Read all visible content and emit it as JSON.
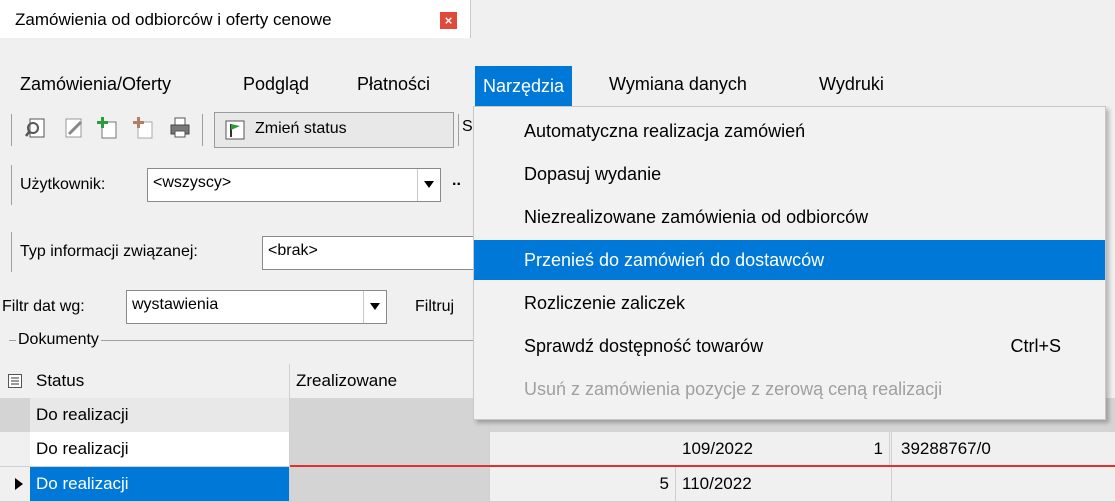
{
  "tab": {
    "title": "Zamówienia od odbiorców i oferty cenowe",
    "close": "×"
  },
  "menu": {
    "items": [
      "Zamówienia/Oferty",
      "Podgląd",
      "Płatności",
      "Narzędzia",
      "Wymiana danych",
      "Wydruki"
    ]
  },
  "toolbar": {
    "change_status": "Zmień status",
    "cut_text": "S"
  },
  "filters": {
    "user_label": "Użytkownik:",
    "user_value": "<wszyscy>",
    "user_more": "..",
    "info_type_label": "Typ informacji związanej:",
    "info_type_value": "<brak>",
    "date_filter_label": "Filtr dat wg:",
    "date_filter_value": "wystawienia",
    "filter_label": "Filtruj"
  },
  "documents": {
    "group_label": "Dokumenty",
    "columns": [
      "Status",
      "Zrealizowane"
    ],
    "rows": [
      {
        "status": "Do realizacji",
        "realized": "",
        "count": "",
        "number": "",
        "ref": ""
      },
      {
        "status": "Do realizacji",
        "realized": "",
        "count": "1",
        "number": "109/2022",
        "ref": "39288767/0"
      },
      {
        "status": "Do realizacji",
        "realized": "",
        "count": "5",
        "number": "110/2022",
        "ref": ""
      }
    ]
  },
  "dropdown": {
    "items": [
      {
        "label": "Automatyczna realizacja zamówień",
        "shortcut": "",
        "state": "normal"
      },
      {
        "label": "Dopasuj wydanie",
        "shortcut": "",
        "state": "normal"
      },
      {
        "label": "Niezrealizowane zamówienia od odbiorców",
        "shortcut": "",
        "state": "normal"
      },
      {
        "label": "Przenieś do zamówień do dostawców",
        "shortcut": "",
        "state": "highlighted"
      },
      {
        "label": "Rozliczenie zaliczek",
        "shortcut": "",
        "state": "normal"
      },
      {
        "label": "Sprawdź dostępność towarów",
        "shortcut": "Ctrl+S",
        "state": "normal"
      },
      {
        "label": "Usuń z zamówienia pozycje z zerową ceną realizacji",
        "shortcut": "",
        "state": "disabled"
      }
    ]
  },
  "colors": {
    "accent": "#0078d7",
    "selected_row": "#0078d7",
    "close_button": "#e04a3a"
  }
}
